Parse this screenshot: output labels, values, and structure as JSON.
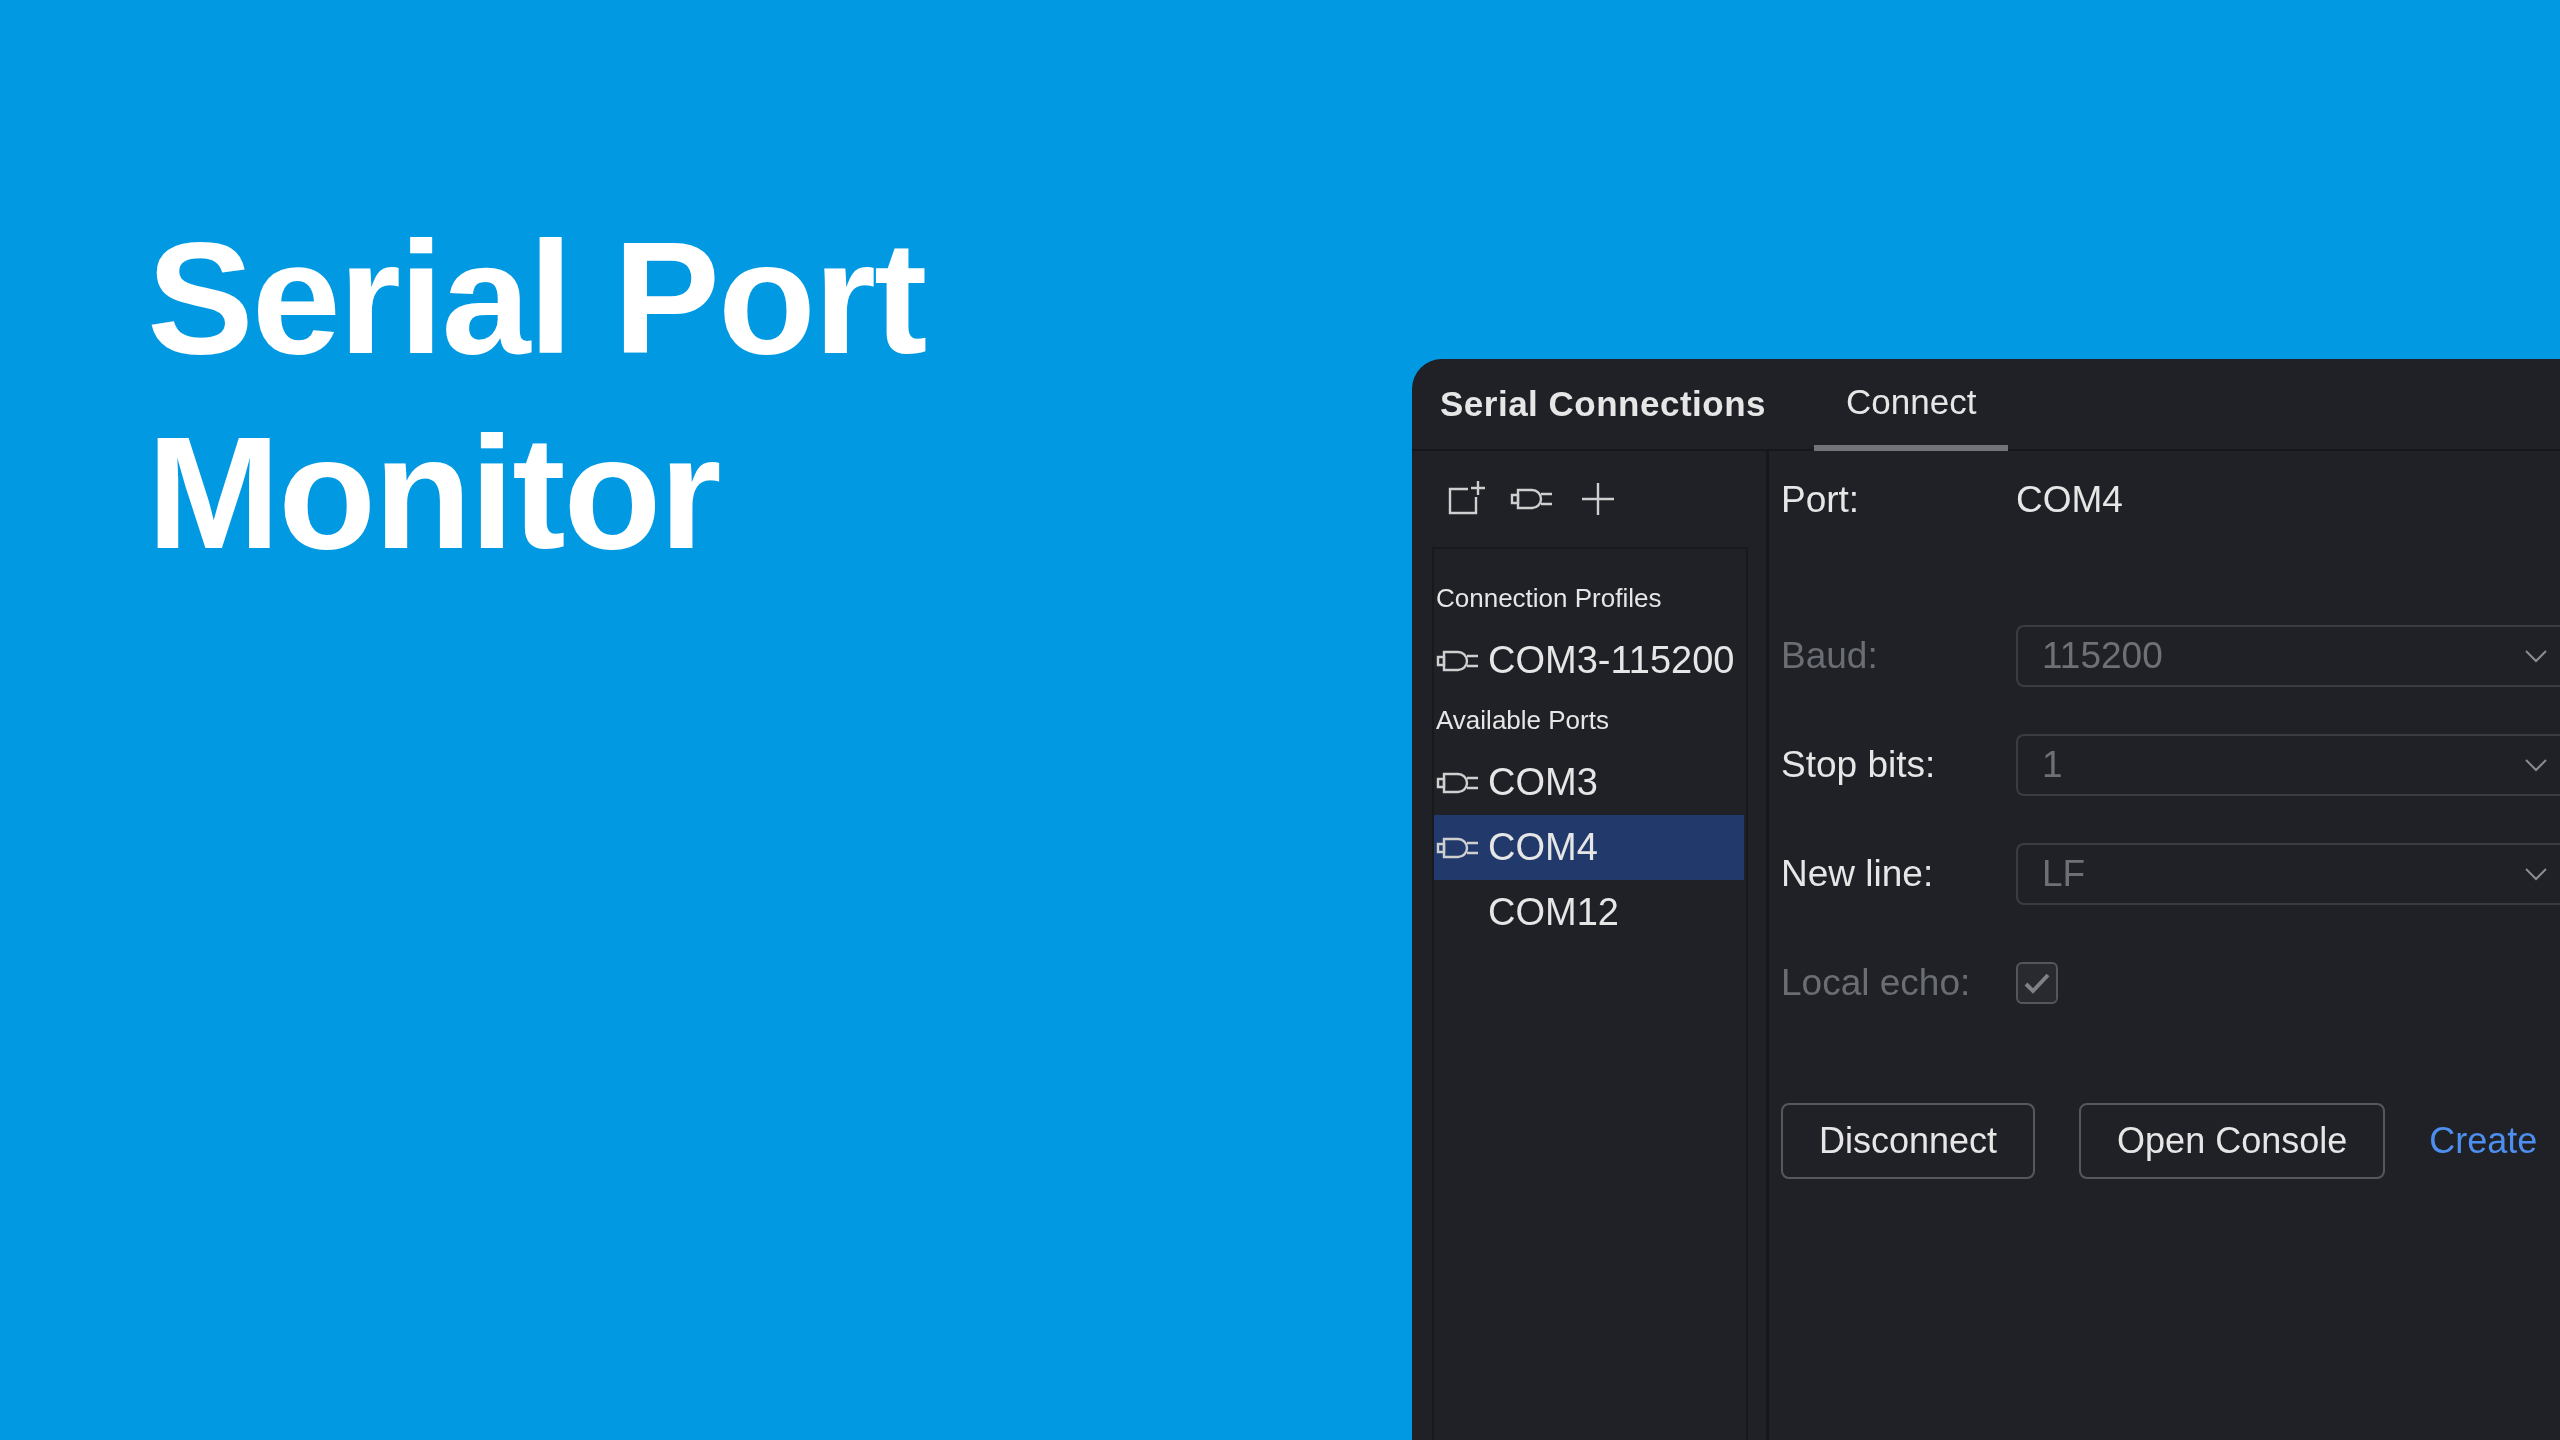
{
  "headline": "Serial Port Monitor",
  "window": {
    "title": "Serial Connections"
  },
  "tabs": [
    {
      "label": "Connect",
      "selected": true
    }
  ],
  "sidebar": {
    "groups": [
      {
        "header": "Connection Profiles",
        "items": [
          {
            "label": "COM3-115200",
            "has_icon": true,
            "selected": false
          }
        ]
      },
      {
        "header": "Available Ports",
        "items": [
          {
            "label": "COM3",
            "has_icon": true,
            "selected": false
          },
          {
            "label": "COM4",
            "has_icon": true,
            "selected": true
          },
          {
            "label": "COM12",
            "has_icon": false,
            "selected": false
          }
        ]
      }
    ]
  },
  "form": {
    "rows": [
      {
        "kind": "value",
        "label": "Port:",
        "value": "COM4",
        "disabled": false
      },
      {
        "kind": "select",
        "label": "Baud:",
        "value": "115200",
        "disabled": true
      },
      {
        "kind": "select",
        "label": "Stop bits:",
        "value": "1",
        "disabled": false
      },
      {
        "kind": "select",
        "label": "New line:",
        "value": "LF",
        "disabled": false
      },
      {
        "kind": "checkbox",
        "label": "Local echo:",
        "checked": true,
        "disabled": true
      }
    ]
  },
  "actions": [
    {
      "kind": "button",
      "label": "Disconnect"
    },
    {
      "kind": "button",
      "label": "Open Console"
    },
    {
      "kind": "link",
      "label": "Create"
    }
  ]
}
